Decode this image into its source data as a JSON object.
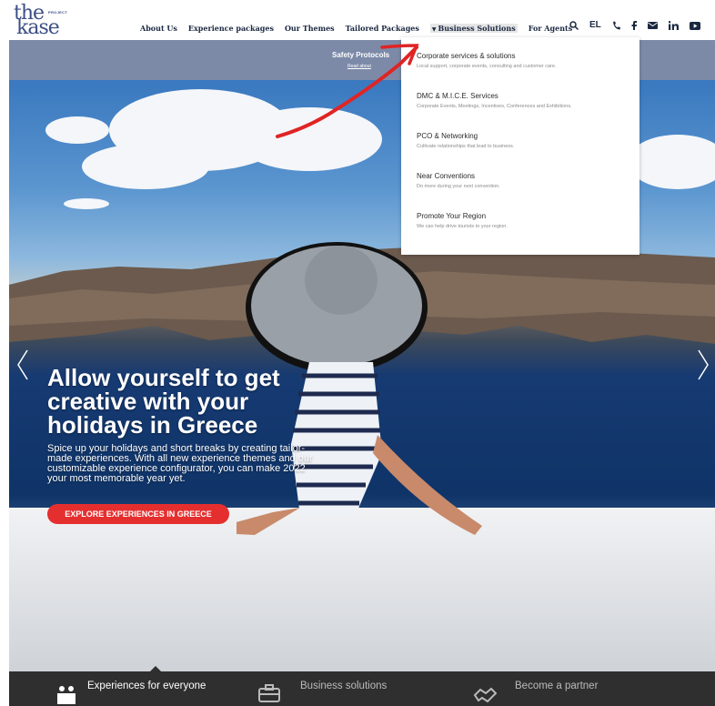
{
  "logo": {
    "the": "the",
    "project": "PROJECT",
    "kase": "kase"
  },
  "nav": {
    "items": [
      "About Us",
      "Experience packages",
      "Our Themes",
      "Tailored Packages"
    ],
    "active": "Business Solutions",
    "agents": "For Agents"
  },
  "header_icons": {
    "lang": "EL",
    "search": "search-icon",
    "phone": "phone-icon",
    "facebook": "facebook-icon",
    "mail": "mail-icon",
    "linkedin": "linkedin-icon",
    "youtube": "youtube-icon"
  },
  "strip": {
    "title": "Safety Protocols",
    "link": "Read about"
  },
  "dropdown": [
    {
      "title": "Corporate services & solutions",
      "desc": "Local support, corporate events, consulting and customer care."
    },
    {
      "title": "DMC & M.I.C.E. Services",
      "desc": "Corporate Events, Meetings, Incentives, Conferences and Exhibitions."
    },
    {
      "title": "PCO & Networking",
      "desc": "Cultivate relationships that lead to business."
    },
    {
      "title": "Near Conventions",
      "desc": "Do more during your next convention."
    },
    {
      "title": "Promote Your Region",
      "desc": "We can help drive tourists to your region."
    }
  ],
  "hero": {
    "title": "Allow yourself to get creative with your holidays in Greece",
    "subtitle": "Spice up your holidays and short breaks by creating tailor-made experiences. With all new experience themes and our customizable experience configurator, you can make 2022 your most memorable year yet.",
    "cta": "EXPLORE EXPERIENCES IN GREECE"
  },
  "features": [
    {
      "label": "Experiences for everyone",
      "icon": "people-icon"
    },
    {
      "label": "Business solutions",
      "icon": "briefcase-icon"
    },
    {
      "label": "Become a partner",
      "icon": "handshake-icon"
    }
  ],
  "colors": {
    "brand": "#3c4f86",
    "cta": "#e52f2f",
    "strip": "#7c8aa8",
    "annotation": "#e02424"
  }
}
